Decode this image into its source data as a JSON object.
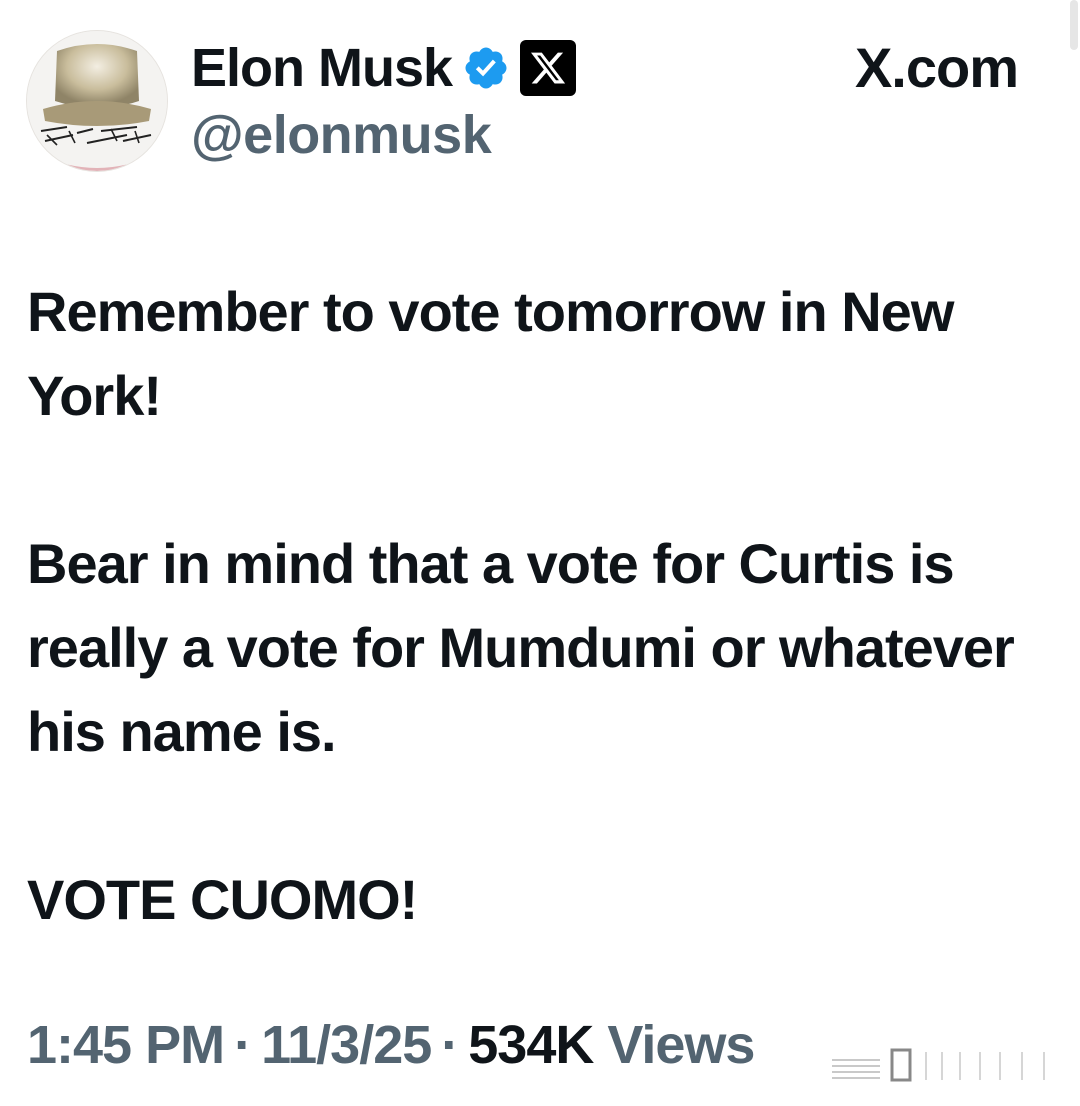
{
  "header": {
    "display_name": "Elon Musk",
    "handle": "@elonmusk",
    "site_label": "X.com",
    "verified": true,
    "icons": {
      "verified": "verified-badge-icon",
      "affiliation": "x-logo-icon",
      "avatar": "avatar-image"
    },
    "accent_color": "#1d9bf0"
  },
  "tweet": {
    "paragraphs": [
      "Remember to vote tomorrow in New York!",
      "Bear in mind that a vote for Curtis is really a vote for Mumdumi or whatever his name is.",
      "VOTE CUOMO!"
    ]
  },
  "meta": {
    "time": "1:45 PM",
    "separator": "·",
    "date": "11/3/25",
    "views_count": "534K",
    "views_label": "Views"
  }
}
